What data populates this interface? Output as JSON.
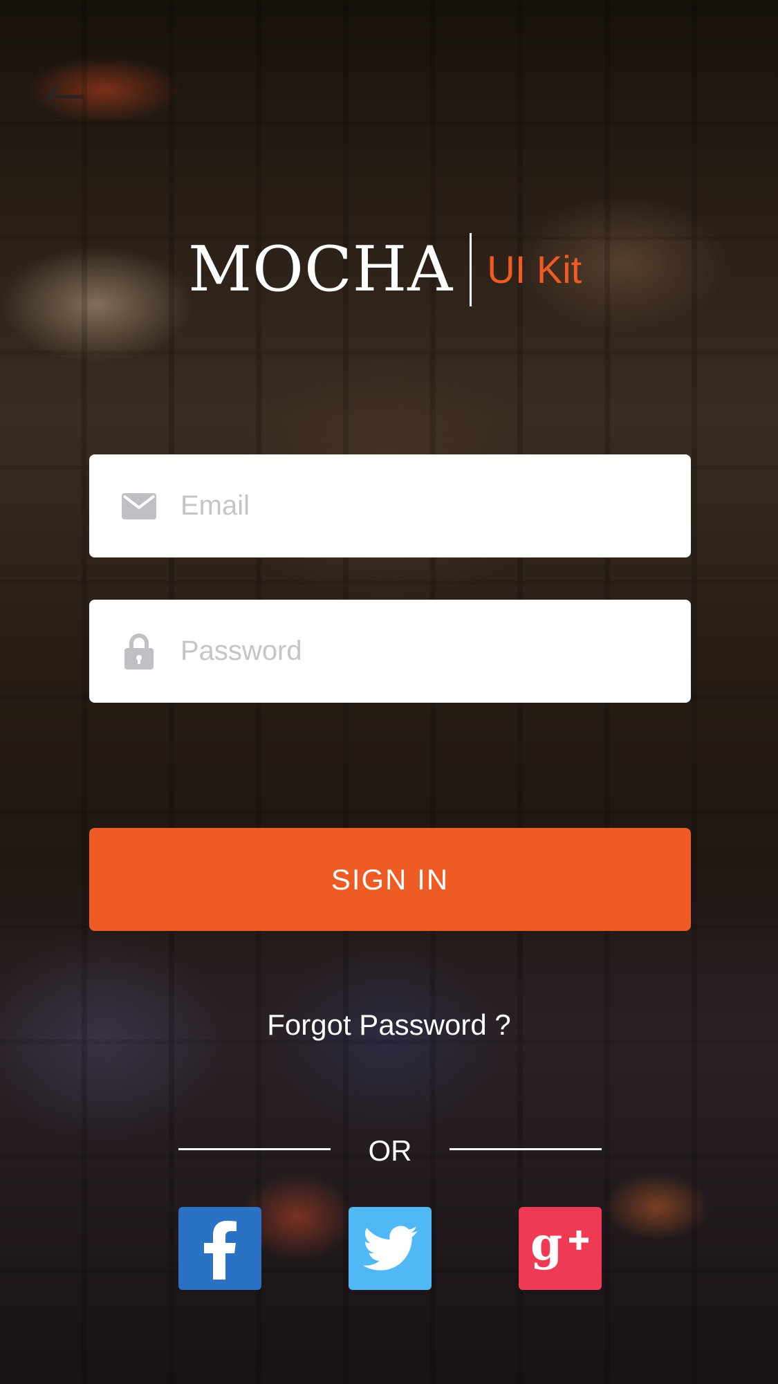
{
  "header": {
    "back_icon": "arrow-left-icon"
  },
  "logo": {
    "brand": "MOCHA",
    "suffix": "UI Kit",
    "suffix_color": "#f05a23"
  },
  "form": {
    "email": {
      "icon": "envelope-icon",
      "placeholder": "Email",
      "value": ""
    },
    "password": {
      "icon": "lock-icon",
      "placeholder": "Password",
      "value": ""
    },
    "sign_in_label": "SIGN IN",
    "sign_in_color": "#f05a23",
    "forgot_label": "Forgot Password ?"
  },
  "divider": {
    "label": "OR"
  },
  "social": [
    {
      "name": "facebook",
      "icon": "facebook-icon",
      "color": "#2b72c5"
    },
    {
      "name": "twitter",
      "icon": "twitter-icon",
      "color": "#50b8f4"
    },
    {
      "name": "google-plus",
      "icon": "google-plus-icon",
      "color": "#ef3a55"
    }
  ]
}
